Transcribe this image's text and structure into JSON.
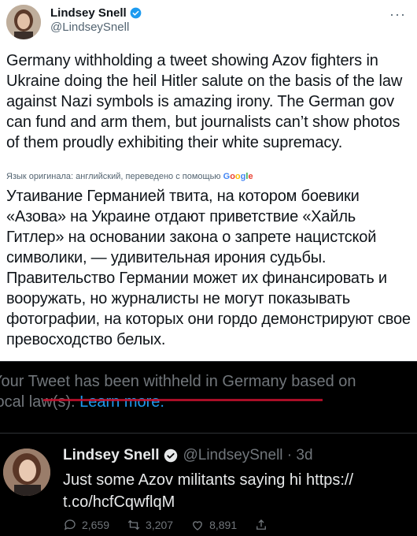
{
  "author": {
    "name": "Lindsey Snell",
    "handle": "@LindseySnell"
  },
  "more_label": "···",
  "tweet": {
    "text": "Germany withholding a tweet showing Azov fighters in Ukraine doing the heil Hitler salute on the basis of the law against Nazi symbols is amazing irony. The German gov can fund and arm them, but journalists can’t show photos of them proudly exhibiting their white supremacy.",
    "translation_note": "Язык оригинала: английский, переведено с помощью ",
    "translation_brand": [
      "G",
      "o",
      "o",
      "g",
      "l",
      "e"
    ],
    "translated_text": "Утаивание Германией твита, на котором боевики «Азова» на Украине отдают приветствие «Хайль Гитлер» на основании закона о запрете нацистской символики, — удивительная ирония судьбы. Правительство Германии может их финансировать и вооружать, но журналисты не могут показывать фотографии, на которых они гордо демонстрируют свое превосходство белых."
  },
  "quoted": {
    "withheld_line1": "Your Tweet has been withheld in Germany based on",
    "withheld_line2": "local law(s). ",
    "learn_more": "Learn more.",
    "author_name": "Lindsey Snell",
    "author_handle": "@LindseySnell · 3d",
    "text": "Just some Azov militants saying hi https:// t.co/hcfCqwflqM",
    "actions": {
      "replies": "2,659",
      "retweets": "3,207",
      "likes": "8,891"
    }
  },
  "colors": {
    "accent": "#1d9bf0",
    "verified": "#1d9bf0",
    "underline": "#c8102e"
  },
  "icons": [
    "verified-badge-icon",
    "more-icon",
    "reply-icon",
    "retweet-icon",
    "like-icon",
    "share-icon"
  ]
}
